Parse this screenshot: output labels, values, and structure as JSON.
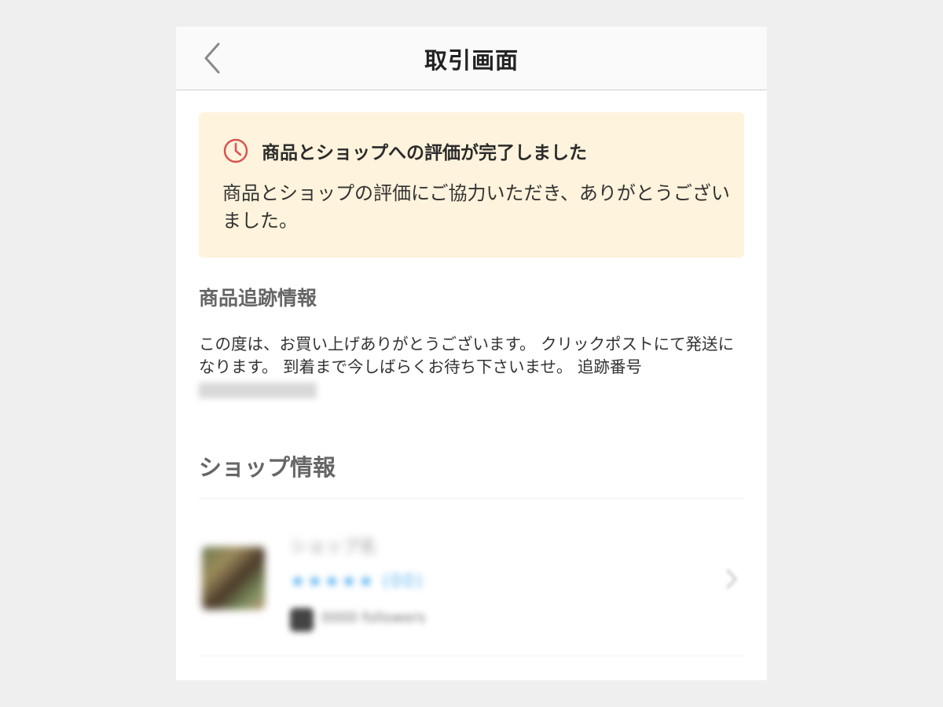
{
  "header": {
    "title": "取引画面",
    "back_icon": "chevron-left-icon"
  },
  "notice": {
    "icon": "clock-icon",
    "icon_color": "#d9534f",
    "background_color": "#fef3dc",
    "title": "商品とショップへの評価が完了しました",
    "body": "商品とショップの評価にご協力いただき、ありがとうございました。"
  },
  "tracking": {
    "section_title": "商品追跡情報",
    "text": "この度は、お買い上げありがとうございます。 クリックポストにて発送になります。 到着まで今しばらくお待ち下さいませ。 追跡番号",
    "number": "0000000000"
  },
  "shop": {
    "section_title": "ショップ情報",
    "name": "ショップ名",
    "rating": "★★★★★ (00)",
    "rating_color": "#5ab3f0",
    "followers": "0000 followers",
    "chevron_icon": "chevron-right-icon"
  }
}
